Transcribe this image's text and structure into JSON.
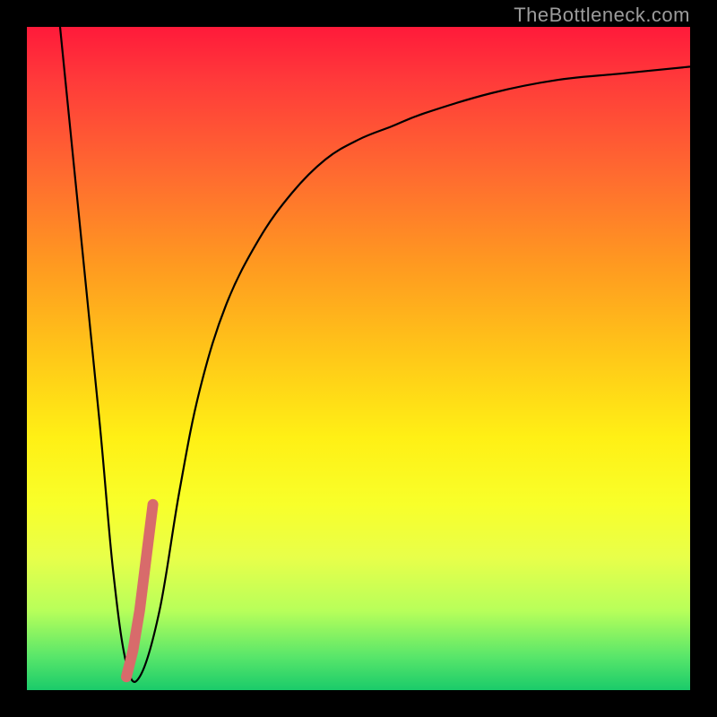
{
  "watermark": "TheBottleneck.com",
  "chart_data": {
    "type": "line",
    "title": "",
    "xlabel": "",
    "ylabel": "",
    "xlim": [
      0,
      100
    ],
    "ylim": [
      0,
      100
    ],
    "grid": false,
    "series": [
      {
        "name": "black-curve",
        "color": "#000000",
        "x": [
          5,
          8,
          11,
          13,
          15,
          17,
          20,
          23,
          26,
          30,
          35,
          40,
          45,
          50,
          55,
          60,
          70,
          80,
          90,
          100
        ],
        "values": [
          100,
          70,
          40,
          18,
          4,
          2,
          12,
          30,
          45,
          58,
          68,
          75,
          80,
          83,
          85,
          87,
          90,
          92,
          93,
          94
        ]
      },
      {
        "name": "pink-highlight",
        "color": "#d86b6b",
        "x": [
          15,
          16,
          17,
          18,
          19
        ],
        "values": [
          2,
          6,
          12,
          20,
          28
        ]
      }
    ]
  }
}
